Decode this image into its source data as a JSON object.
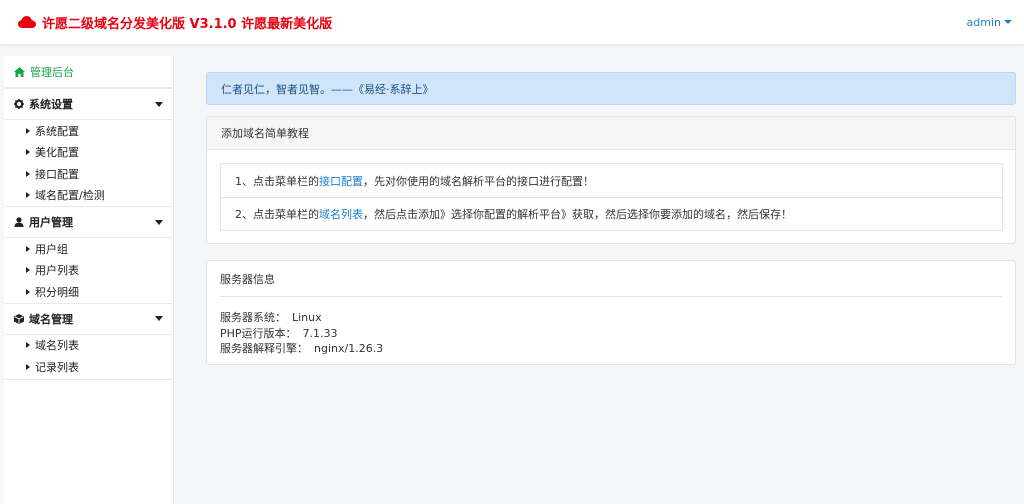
{
  "header": {
    "title": "许愿二级域名分发美化版 V3.1.0 许愿最新美化版",
    "logo_icon": "cloud-icon",
    "brand_color": "#e60012",
    "user_menu": "admin"
  },
  "sidebar": {
    "home": {
      "label": "管理后台",
      "icon": "home-icon",
      "color": "#16a34a"
    },
    "groups": [
      {
        "label": "系统设置",
        "icon": "gear-icon",
        "items": [
          "系统配置",
          "美化配置",
          "接口配置",
          "域名配置/检测"
        ]
      },
      {
        "label": "用户管理",
        "icon": "user-icon",
        "items": [
          "用户组",
          "用户列表",
          "积分明细"
        ]
      },
      {
        "label": "域名管理",
        "icon": "cube-icon",
        "items": [
          "域名列表",
          "记录列表"
        ]
      }
    ]
  },
  "main": {
    "alert": "仁者见仁，智者见智。——《易经·系辞上》",
    "tutorial": {
      "title": "添加域名简单教程",
      "step1": {
        "prefix": "1、点击菜单栏的",
        "link": "接口配置",
        "suffix": "，先对你使用的域名解析平台的接口进行配置！"
      },
      "step2": {
        "prefix": "2、点击菜单栏的",
        "link": "域名列表",
        "suffix": "，然后点击添加》选择你配置的解析平台》获取，然后选择你要添加的域名，然后保存！"
      }
    },
    "server": {
      "title": "服务器信息",
      "os_label": "服务器系统：",
      "os_value": "Linux",
      "php_label": "PHP运行版本：",
      "php_value": "7.1.33",
      "engine_label": "服务器解释引擎：",
      "engine_value": "nginx/1.26.3"
    }
  }
}
